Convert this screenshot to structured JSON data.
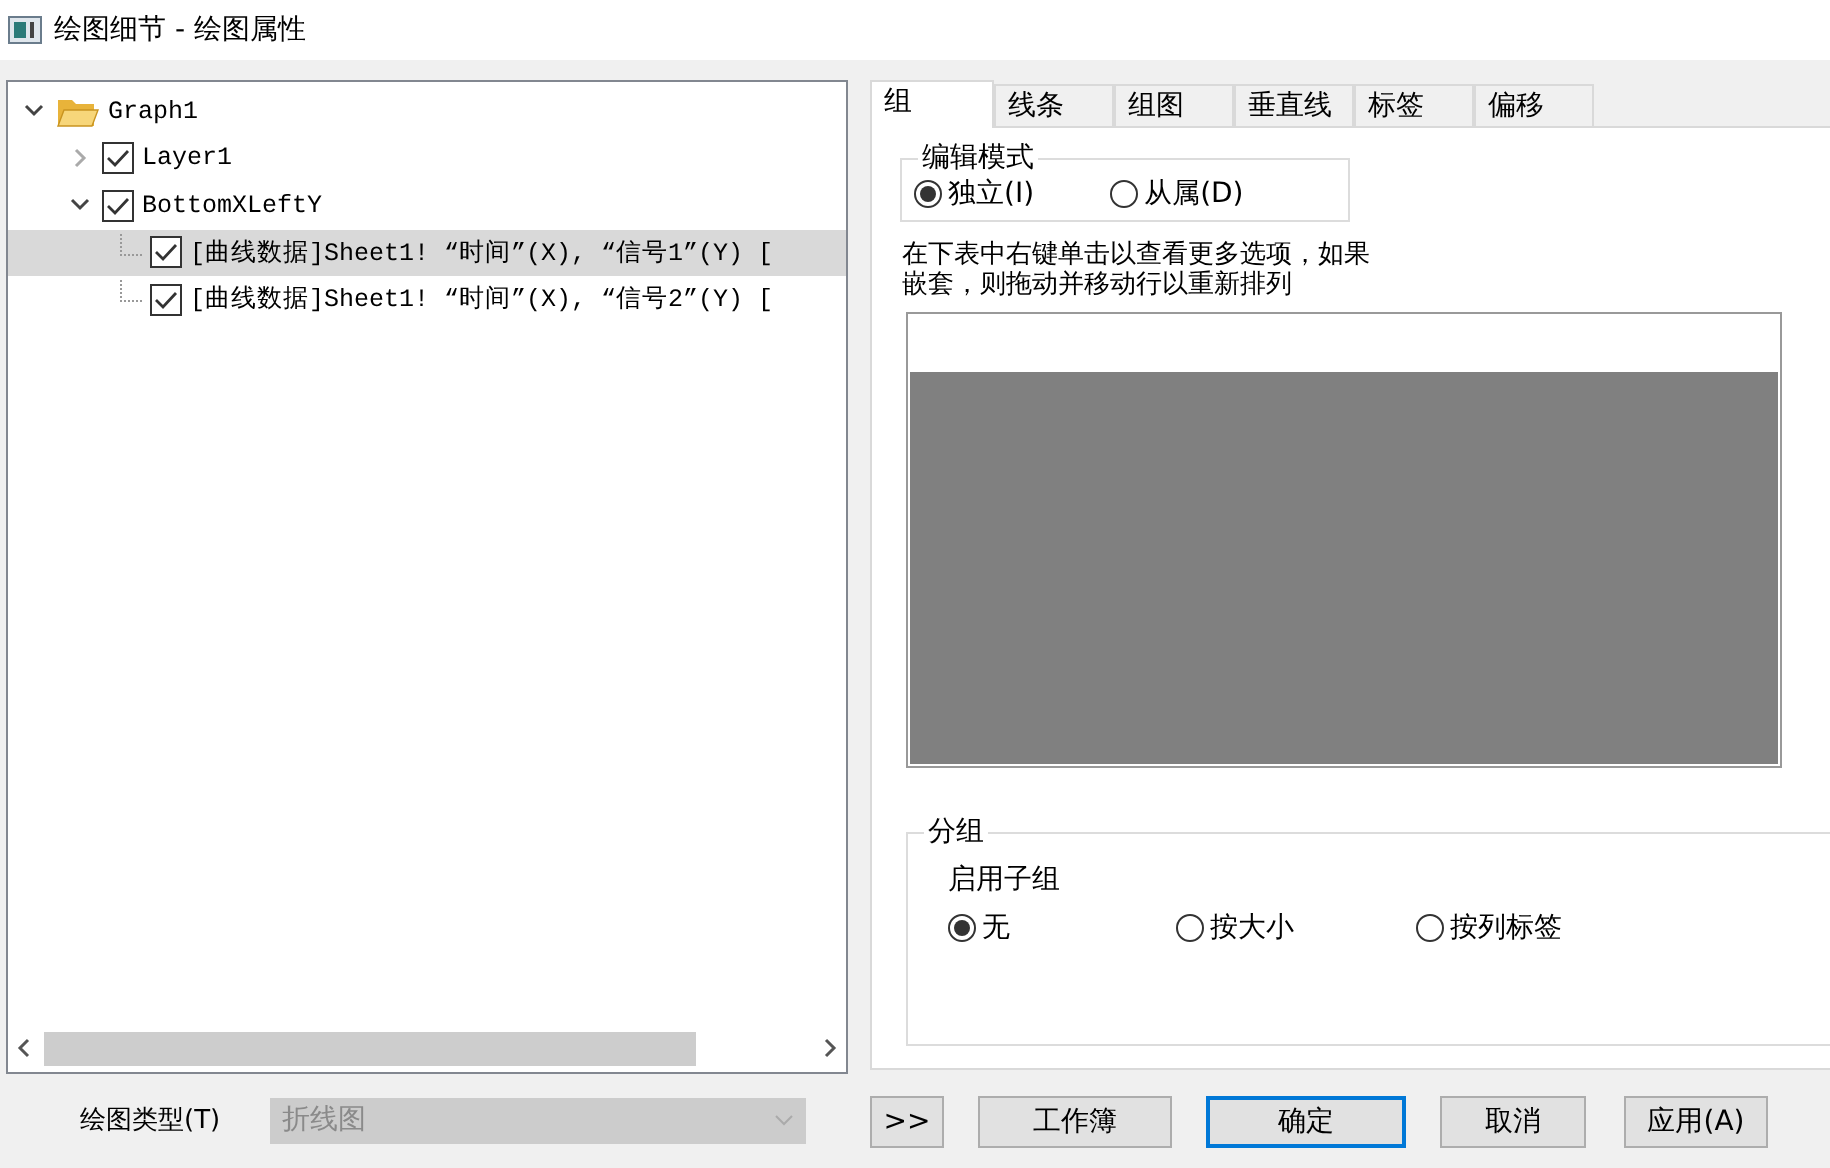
{
  "window": {
    "title": "绘图细节 - 绘图属性"
  },
  "tree": [
    {
      "label": "Graph1",
      "kind": "folder",
      "expanded": true,
      "children": [
        {
          "label": "Layer1",
          "kind": "item",
          "checked": true,
          "expanded": false
        },
        {
          "label": "BottomXLeftY",
          "kind": "item",
          "checked": true,
          "expanded": true,
          "children": [
            {
              "label": "[曲线数据]Sheet1! “时间”(X), “信号1”(Y) [",
              "kind": "item",
              "checked": true,
              "selected": true
            },
            {
              "label": "[曲线数据]Sheet1! “时间”(X), “信号2”(Y) [",
              "kind": "item",
              "checked": true,
              "selected": false
            }
          ]
        }
      ]
    }
  ],
  "plot_type": {
    "label": "绘图类型(T)",
    "value": "折线图",
    "disabled": true
  },
  "tabs": [
    {
      "label": "组",
      "selected": true
    },
    {
      "label": "线条",
      "selected": false
    },
    {
      "label": "组图",
      "selected": false
    },
    {
      "label": "垂直线",
      "selected": false
    },
    {
      "label": "标签",
      "selected": false
    },
    {
      "label": "偏移",
      "selected": false
    }
  ],
  "edit_mode": {
    "title": "编辑模式",
    "options": [
      {
        "label": "独立(I)",
        "selected": true
      },
      {
        "label": "从属(D)",
        "selected": false
      }
    ]
  },
  "hint": "在下表中右键单击以查看更多选项，如果嵌套，则拖动并移动行以重新排列",
  "grouping": {
    "title": "分组",
    "subtitle": "启用子组",
    "options": [
      {
        "label": "无",
        "selected": true
      },
      {
        "label": "按大小",
        "selected": false
      },
      {
        "label": "按列标签",
        "selected": false
      }
    ]
  },
  "buttons": [
    {
      "label": ">>",
      "default": false
    },
    {
      "label": "工作簿",
      "default": false
    },
    {
      "label": "确定",
      "default": true
    },
    {
      "label": "取消",
      "default": false
    },
    {
      "label": "应用(A)",
      "default": false
    }
  ]
}
